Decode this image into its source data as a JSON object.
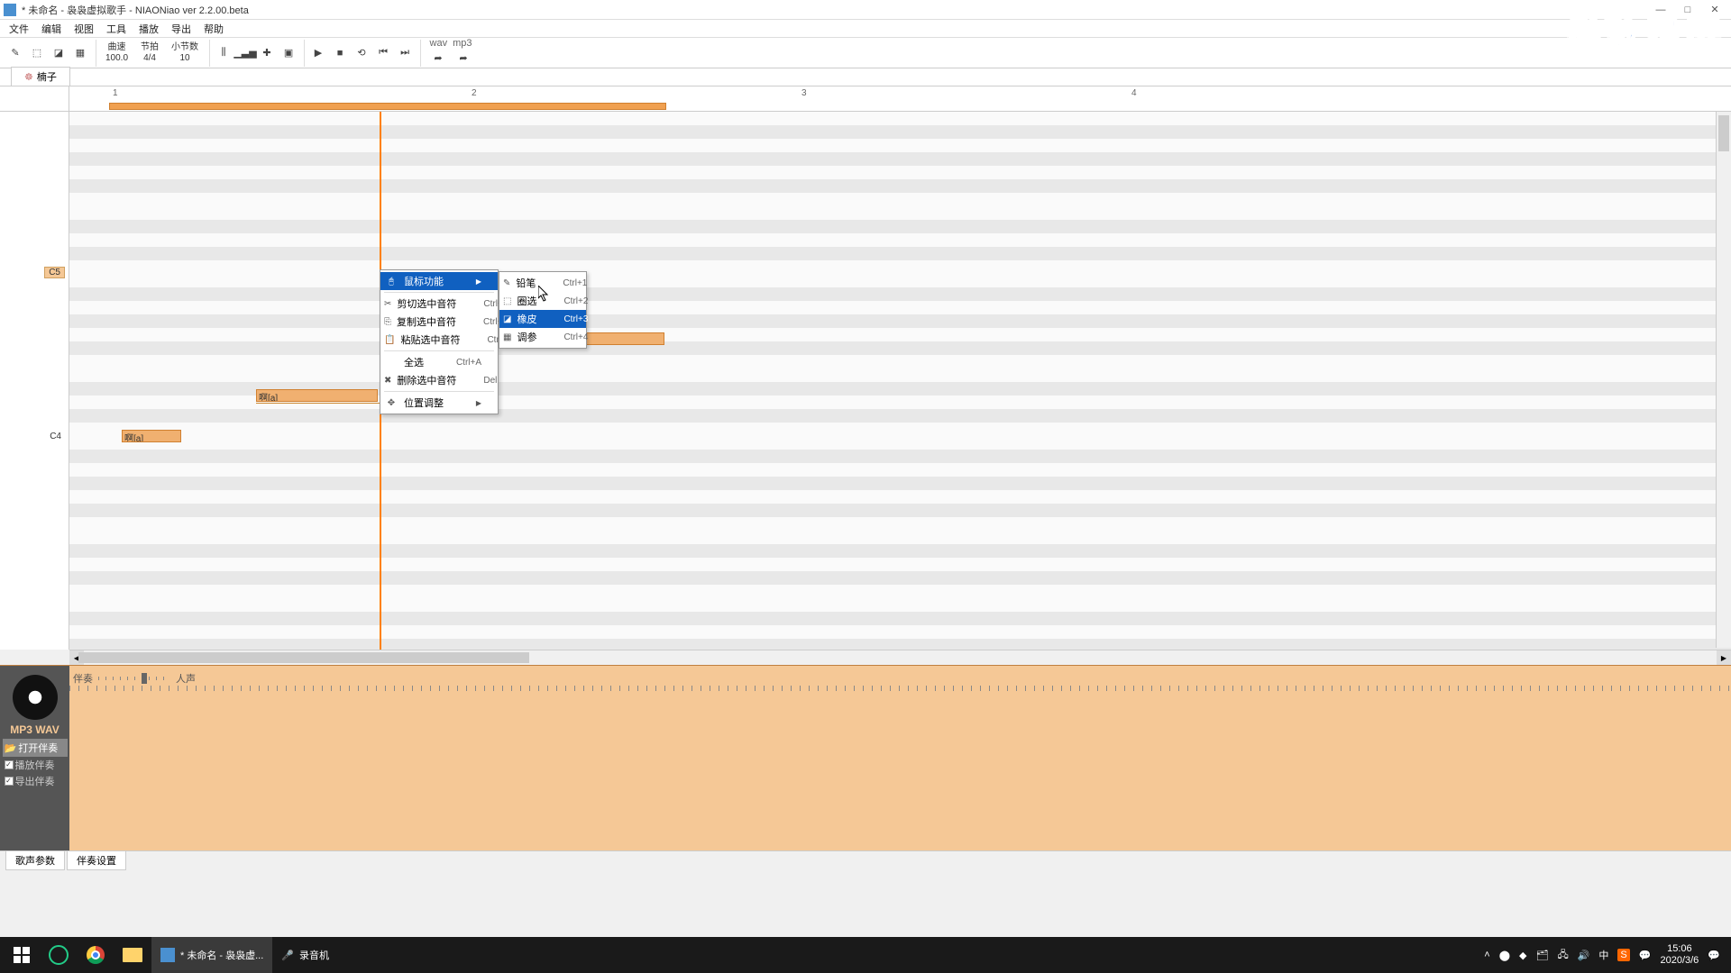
{
  "window": {
    "title": "* 未命名 - 袅袅虚拟歌手 - NIAONiao ver 2.2.00.beta",
    "min": "—",
    "max": "□",
    "close": "✕"
  },
  "menu": {
    "file": "文件",
    "edit": "编辑",
    "view": "视图",
    "tool": "工具",
    "play": "播放",
    "export": "导出",
    "help": "帮助"
  },
  "toolbar": {
    "tempo_lbl": "曲速",
    "tempo_val": "100.0",
    "beat_lbl": "节拍",
    "beat_val": "4/4",
    "bars_lbl": "小节数",
    "bars_val": "10",
    "wav": "wav",
    "mp3": "mp3"
  },
  "tab": {
    "voice_name": "楠子"
  },
  "ruler": {
    "m1": "1",
    "m2": "2",
    "m3": "3",
    "m4": "4"
  },
  "piano": {
    "c5": "C5",
    "c4": "C4"
  },
  "notes": {
    "n1": "啊[a]",
    "n2": "啊[a]"
  },
  "ctx1": {
    "mouse": "鼠标功能",
    "cut": "剪切选中音符",
    "cut_sc": "Ctrl+X",
    "copy": "复制选中音符",
    "copy_sc": "Ctrl+C",
    "paste": "粘贴选中音符",
    "paste_sc": "Ctrl+V",
    "all": "全选",
    "all_sc": "Ctrl+A",
    "del": "删除选中音符",
    "del_sc": "Del",
    "pos": "位置调整"
  },
  "ctx2": {
    "pencil": "铅笔",
    "pencil_sc": "Ctrl+1",
    "select": "圈选",
    "select_sc": "Ctrl+2",
    "eraser": "橡皮",
    "eraser_sc": "Ctrl+3",
    "param": "调参",
    "param_sc": "Ctrl+4"
  },
  "lower": {
    "mp3wav": "MP3 WAV",
    "open": "打开伴奏",
    "chk1": "播放伴奏",
    "chk2": "导出伴奏",
    "slider_left": "伴奏",
    "slider_right": "人声"
  },
  "bottom_tabs": {
    "t1": "歌声参数",
    "t2": "伴奏设置"
  },
  "taskbar": {
    "app1": "* 未命名 - 袅袅虚...",
    "app2": "录音机",
    "time": "15:06",
    "date": "2020/3/6"
  },
  "watermark": "傲软录屏"
}
